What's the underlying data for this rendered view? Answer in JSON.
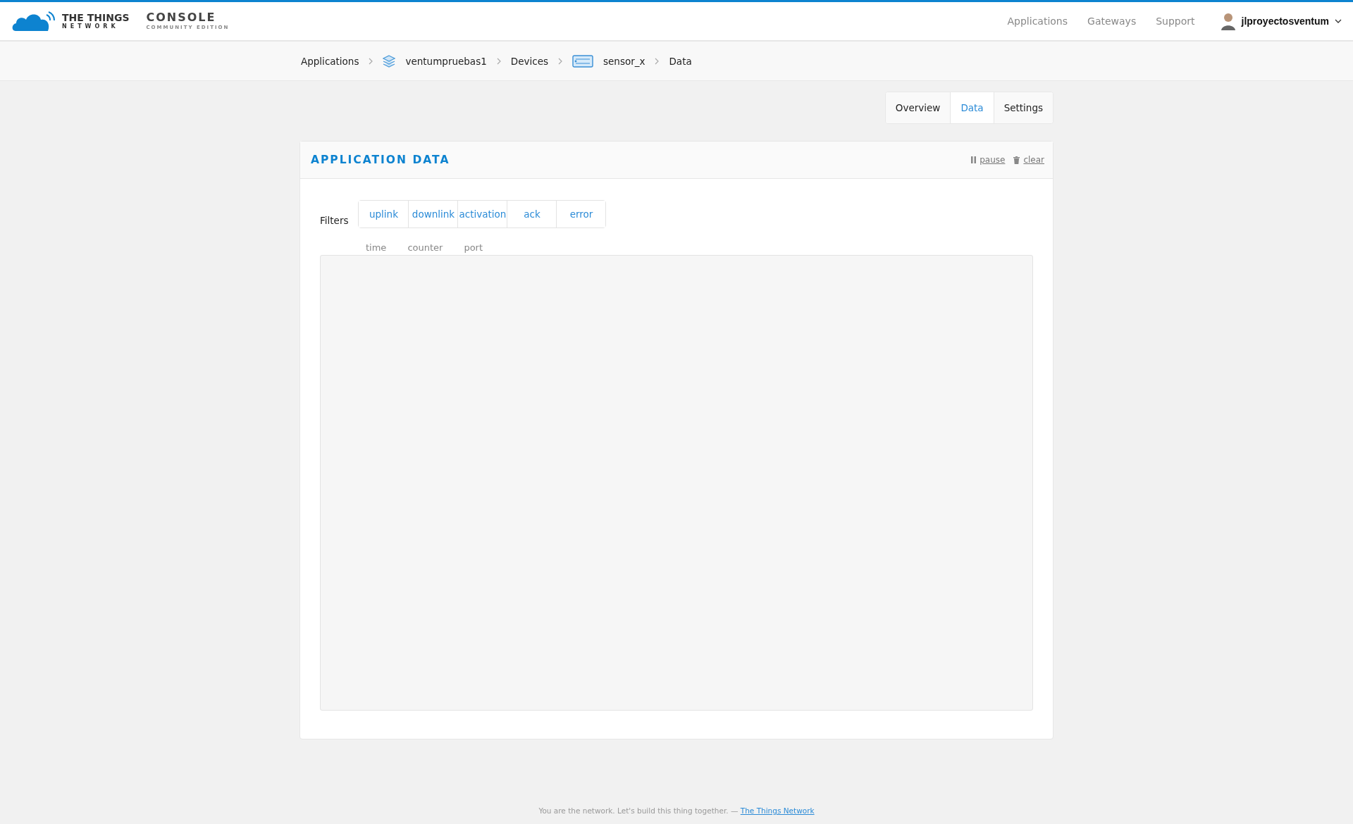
{
  "header": {
    "logo": {
      "line1": "THE THINGS",
      "line2": "NETWORK",
      "product": "CONSOLE",
      "edition": "COMMUNITY EDITION"
    },
    "nav": [
      "Applications",
      "Gateways",
      "Support"
    ],
    "user": {
      "name": "jlproyectosventum"
    }
  },
  "breadcrumb": [
    {
      "label": "Applications",
      "kind": "link"
    },
    {
      "label": "ventumpruebas1",
      "kind": "application"
    },
    {
      "label": "Devices",
      "kind": "link"
    },
    {
      "label": "sensor_x",
      "kind": "device"
    },
    {
      "label": "Data",
      "kind": "current"
    }
  ],
  "tabs": [
    {
      "label": "Overview",
      "selected": false
    },
    {
      "label": "Data",
      "selected": true
    },
    {
      "label": "Settings",
      "selected": false
    }
  ],
  "card": {
    "title": "APPLICATION DATA",
    "actions": [
      {
        "label": "pause",
        "kind": "pause"
      },
      {
        "label": "clear",
        "kind": "clear"
      }
    ],
    "filters_label": "Filters",
    "filters": [
      "uplink",
      "downlink",
      "activation",
      "ack",
      "error"
    ],
    "columns": [
      "time",
      "counter",
      "port"
    ]
  },
  "footer": {
    "text": "You are the network. Let's build this thing together. —",
    "link": "The Things Network"
  }
}
